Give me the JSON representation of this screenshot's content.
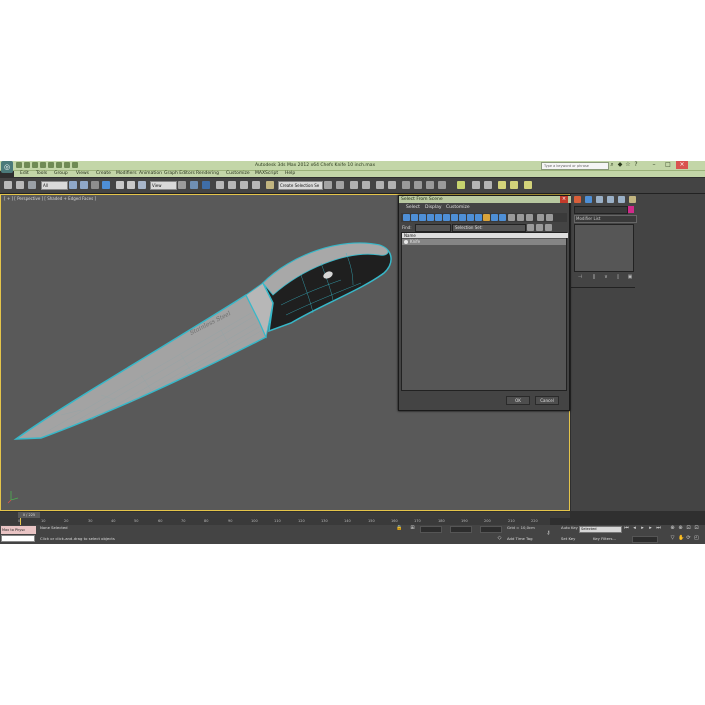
{
  "app": {
    "title": "Autodesk 3ds Max 2012 x64     Chefs Knife 10 inch.max",
    "search_placeholder": "Type a keyword or phrase",
    "menus": [
      "Edit",
      "Tools",
      "Group",
      "Views",
      "Create",
      "Modifiers",
      "Animation",
      "Graph Editors",
      "Rendering",
      "Customize",
      "MAXScript",
      "Help"
    ]
  },
  "toolbar": {
    "selection_filter": "All",
    "reference_coord": "View",
    "named_selection": "Create Selection Se"
  },
  "viewport": {
    "label": "[ + ] [ Perspective ] [ Shaded + Edged Faces ]",
    "engraving": "Stainless Steel"
  },
  "command_panel": {
    "modifier_list": "Modifier List",
    "accent_color": "#d12a8a"
  },
  "dialog": {
    "title": "Select From Scene",
    "menus": [
      "Select",
      "Display",
      "Customize"
    ],
    "find_label": "Find:",
    "selection_set_label": "Selection Set:",
    "column_name": "Name",
    "items": [
      "Knife"
    ],
    "ok_label": "OK",
    "cancel_label": "Cancel"
  },
  "timeline": {
    "slider_label": "0 / 225",
    "ticks": [
      "0",
      "10",
      "20",
      "30",
      "40",
      "50",
      "60",
      "70",
      "80",
      "90",
      "100",
      "110",
      "120",
      "130",
      "140",
      "150",
      "160",
      "170",
      "180",
      "190",
      "200",
      "210",
      "220"
    ]
  },
  "status": {
    "maxscript_line1": "Max to Physc",
    "maxscript_line2": "",
    "selection": "None Selected",
    "prompt": "Click or click-and-drag to select objects",
    "grid": "Grid = 10,0cm",
    "add_time_tag": "Add Time Tag",
    "auto_key": "Auto Key",
    "set_key": "Set Key",
    "key_mode": "Selected",
    "key_filters": "Key Filters..."
  }
}
